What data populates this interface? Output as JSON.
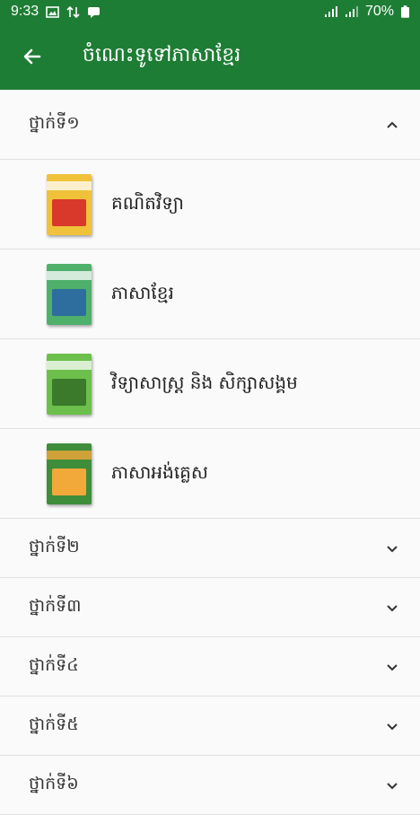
{
  "status_bar": {
    "time": "9:33",
    "battery": "70%",
    "icons": [
      "image-icon",
      "transfer-icon",
      "chat-icon",
      "signal-icon",
      "signal-icon",
      "battery-icon"
    ]
  },
  "app_bar": {
    "back_icon": "arrow-left-icon",
    "title": "ចំណេះទូទៅភាសាខ្មែរ"
  },
  "grades": [
    {
      "label": "ថ្នាក់ទី១",
      "expanded": true,
      "books": [
        {
          "title": "គណិតវិទ្យា",
          "cover_color": "#f0c23a",
          "accent": "#d8392b"
        },
        {
          "title": "ភាសាខ្មែរ",
          "cover_color": "#4fb06b",
          "accent": "#2d6e9e"
        },
        {
          "title": "វិទ្យាសាស្ត្រ និង សិក្សាសង្គម",
          "cover_color": "#6cbf4b",
          "accent": "#3a7a2a"
        },
        {
          "title": "ភាសាអង់គ្លេស",
          "cover_color": "#3e8d3a",
          "accent": "#f3a83a"
        }
      ]
    },
    {
      "label": "ថ្នាក់ទី២",
      "expanded": false
    },
    {
      "label": "ថ្នាក់ទី៣",
      "expanded": false
    },
    {
      "label": "ថ្នាក់ទី៤",
      "expanded": false
    },
    {
      "label": "ថ្នាក់ទី៥",
      "expanded": false
    },
    {
      "label": "ថ្នាក់ទី៦",
      "expanded": false
    }
  ],
  "colors": {
    "primary": "#1e7d34",
    "divider": "#e0e0e0",
    "background": "#fafafa"
  }
}
